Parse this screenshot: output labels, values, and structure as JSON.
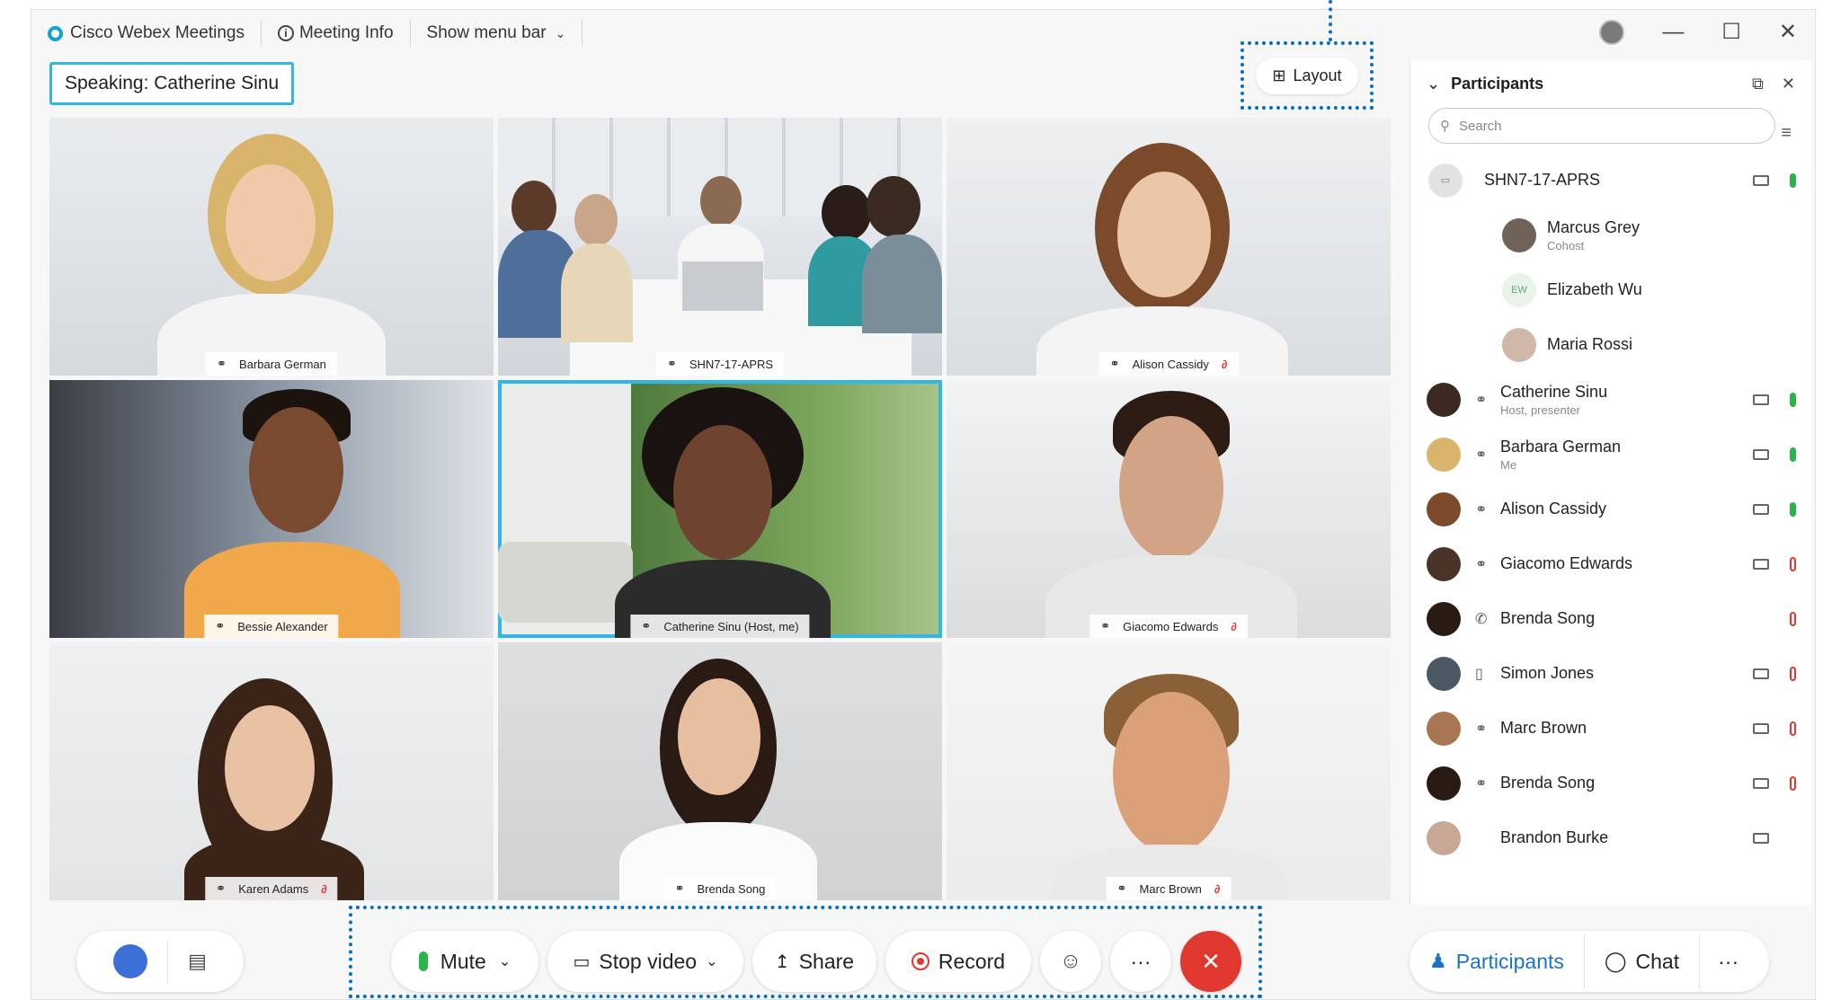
{
  "titlebar": {
    "app_name": "Cisco Webex Meetings",
    "meeting_info": "Meeting Info",
    "show_menu_bar": "Show menu bar",
    "window_controls": [
      "—",
      "☐",
      "✕"
    ]
  },
  "speaking_label": "Speaking: Catherine Sinu",
  "layout_button": "Layout",
  "video_tiles": [
    {
      "name": "Barbara German",
      "muted": false,
      "active": false
    },
    {
      "name": "SHN7-17-APRS",
      "muted": false,
      "active": false
    },
    {
      "name": "Alison Cassidy",
      "muted": true,
      "active": false
    },
    {
      "name": "Bessie Alexander",
      "muted": false,
      "active": false
    },
    {
      "name": "Catherine Sinu (Host, me)",
      "muted": false,
      "active": true
    },
    {
      "name": "Giacomo Edwards",
      "muted": true,
      "active": false
    },
    {
      "name": "Karen Adams",
      "muted": true,
      "active": false
    },
    {
      "name": "Brenda Song",
      "muted": false,
      "active": false
    },
    {
      "name": "Marc Brown",
      "muted": true,
      "active": false
    }
  ],
  "participants_panel": {
    "title": "Participants",
    "search_placeholder": "Search",
    "rows": [
      {
        "name": "SHN7-17-APRS",
        "sub": "",
        "indent": false,
        "device": true,
        "cam": true,
        "mic": "on",
        "status": ""
      },
      {
        "name": "Marcus Grey",
        "sub": "Cohost",
        "indent": true,
        "cam": false,
        "mic": "",
        "status": ""
      },
      {
        "name": "Elizabeth Wu",
        "sub": "",
        "indent": true,
        "initials": "EW",
        "cam": false,
        "mic": "",
        "status": ""
      },
      {
        "name": "Maria Rossi",
        "sub": "",
        "indent": true,
        "cam": false,
        "mic": "",
        "status": ""
      },
      {
        "name": "Catherine Sinu",
        "sub": "Host, presenter",
        "indent": false,
        "cam": true,
        "mic": "on",
        "status": "computer"
      },
      {
        "name": "Barbara German",
        "sub": "Me",
        "indent": false,
        "cam": true,
        "mic": "on",
        "status": "computer"
      },
      {
        "name": "Alison Cassidy",
        "sub": "",
        "indent": false,
        "cam": true,
        "mic": "on",
        "status": "computer"
      },
      {
        "name": "Giacomo Edwards",
        "sub": "",
        "indent": false,
        "cam": true,
        "mic": "off",
        "status": "computer"
      },
      {
        "name": "Brenda Song",
        "sub": "",
        "indent": false,
        "cam": false,
        "mic": "off",
        "status": "phone"
      },
      {
        "name": "Simon Jones",
        "sub": "",
        "indent": false,
        "cam": true,
        "mic": "off",
        "status": "mobile"
      },
      {
        "name": "Marc Brown",
        "sub": "",
        "indent": false,
        "cam": true,
        "mic": "off",
        "status": "computer"
      },
      {
        "name": "Brenda Song",
        "sub": "",
        "indent": false,
        "cam": true,
        "mic": "off",
        "status": "computer"
      },
      {
        "name": "Brandon Burke",
        "sub": "",
        "indent": false,
        "cam": true,
        "mic": "",
        "status": ""
      }
    ]
  },
  "controls": {
    "mute": "Mute",
    "stop_video": "Stop video",
    "share": "Share",
    "record": "Record",
    "more": "···",
    "end": "✕"
  },
  "right_controls": {
    "participants": "Participants",
    "chat": "Chat",
    "more": "···"
  },
  "colors": {
    "accent": "#33b6e6",
    "highlight_frame": "#0a6fb8",
    "end_call": "#e0382f",
    "mic_on": "#2bb34a",
    "mic_off": "#e0382f"
  }
}
